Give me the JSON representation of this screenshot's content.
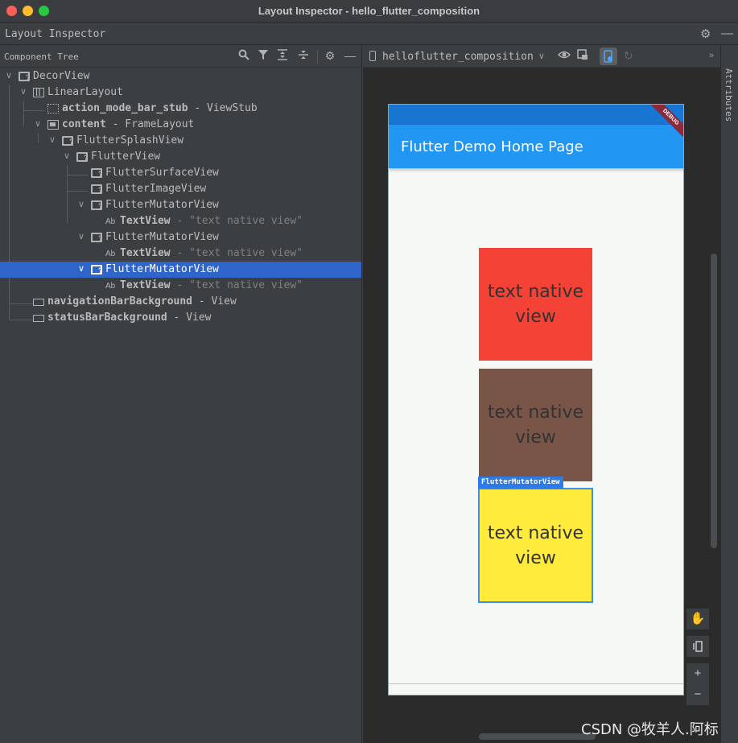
{
  "window": {
    "title": "Layout Inspector - hello_flutter_composition"
  },
  "tool_window": {
    "title": "Layout Inspector"
  },
  "tree_panel": {
    "title": "Component Tree",
    "rows": [
      {
        "name": "DecorView",
        "type": "",
        "text": ""
      },
      {
        "name": "LinearLayout",
        "type": "",
        "text": ""
      },
      {
        "name": "action_mode_bar_stub",
        "sep": " - ",
        "type": "ViewStub",
        "text": ""
      },
      {
        "name": "content",
        "sep": " - ",
        "type": "FrameLayout",
        "text": ""
      },
      {
        "name": "FlutterSplashView",
        "type": "",
        "text": ""
      },
      {
        "name": "FlutterView",
        "type": "",
        "text": ""
      },
      {
        "name": "FlutterSurfaceView",
        "type": "",
        "text": ""
      },
      {
        "name": "FlutterImageView",
        "type": "",
        "text": ""
      },
      {
        "name": "FlutterMutatorView",
        "type": "",
        "text": ""
      },
      {
        "name": "TextView",
        "sep": " - ",
        "text": "\"text native view\""
      },
      {
        "name": "FlutterMutatorView",
        "type": "",
        "text": ""
      },
      {
        "name": "TextView",
        "sep": " - ",
        "text": "\"text native view\""
      },
      {
        "name": "FlutterMutatorView",
        "type": "",
        "text": ""
      },
      {
        "name": "TextView",
        "sep": " - ",
        "text": "\"text native view\""
      },
      {
        "name": "navigationBarBackground",
        "sep": " - ",
        "type": "View",
        "text": ""
      },
      {
        "name": "statusBarBackground",
        "sep": " - ",
        "type": "View",
        "text": ""
      }
    ],
    "ab_label": "Ab",
    "selected_index": 12
  },
  "inspector_toolbar": {
    "process": "helloflutter_composition"
  },
  "side_panel": {
    "label": "Attributes"
  },
  "device": {
    "app_title": "Flutter Demo Home Page",
    "debug_banner": "DEBUG",
    "boxes": [
      {
        "text": "text native view",
        "color": "#f44336"
      },
      {
        "text": "text native view",
        "color": "#795548"
      },
      {
        "text": "text native view",
        "color": "#ffeb3b"
      }
    ],
    "selection_tag": "FlutterMutatorView"
  },
  "canvas_tools": {
    "zoom_in": "+",
    "zoom_out": "−"
  },
  "watermark": "CSDN @牧羊人.阿标",
  "colors": {
    "selection": "#2f65ca",
    "app_bar": "#2196f3",
    "status_bar": "#1975d2"
  }
}
